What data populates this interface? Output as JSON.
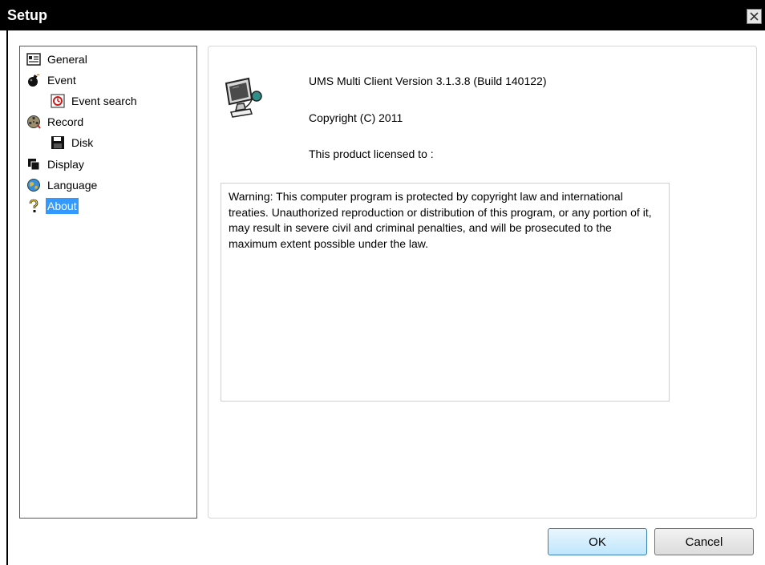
{
  "window": {
    "title": "Setup",
    "close_icon": "close-icon"
  },
  "tree": {
    "items": [
      {
        "label": "General",
        "icon": "general-settings-icon"
      },
      {
        "label": "Event",
        "icon": "bomb-event-icon"
      },
      {
        "label": "Event search",
        "icon": "event-search-icon"
      },
      {
        "label": "Record",
        "icon": "film-reel-record-icon"
      },
      {
        "label": "Disk",
        "icon": "floppy-disk-icon"
      },
      {
        "label": "Display",
        "icon": "display-windows-icon"
      },
      {
        "label": "Language",
        "icon": "globe-language-icon"
      },
      {
        "label": "About",
        "icon": "question-mark-about-icon"
      }
    ],
    "selected": "About"
  },
  "about": {
    "app_icon": "computer-icon",
    "version": "UMS Multi Client Version 3.1.3.8 (Build 140122)",
    "copyright": "Copyright (C) 2011",
    "license": "This product licensed to :",
    "warning": "Warning: This computer program is protected by copyright law and international treaties. Unauthorized reproduction or distribution of this program, or any portion of it, may result in severe civil and criminal penalties, and will be prosecuted to the maximum extent possible under the law."
  },
  "buttons": {
    "ok": "OK",
    "cancel": "Cancel"
  },
  "colors": {
    "titlebar": "#000000",
    "selection": "#3399ff",
    "ok_border": "#3c7fb1"
  }
}
